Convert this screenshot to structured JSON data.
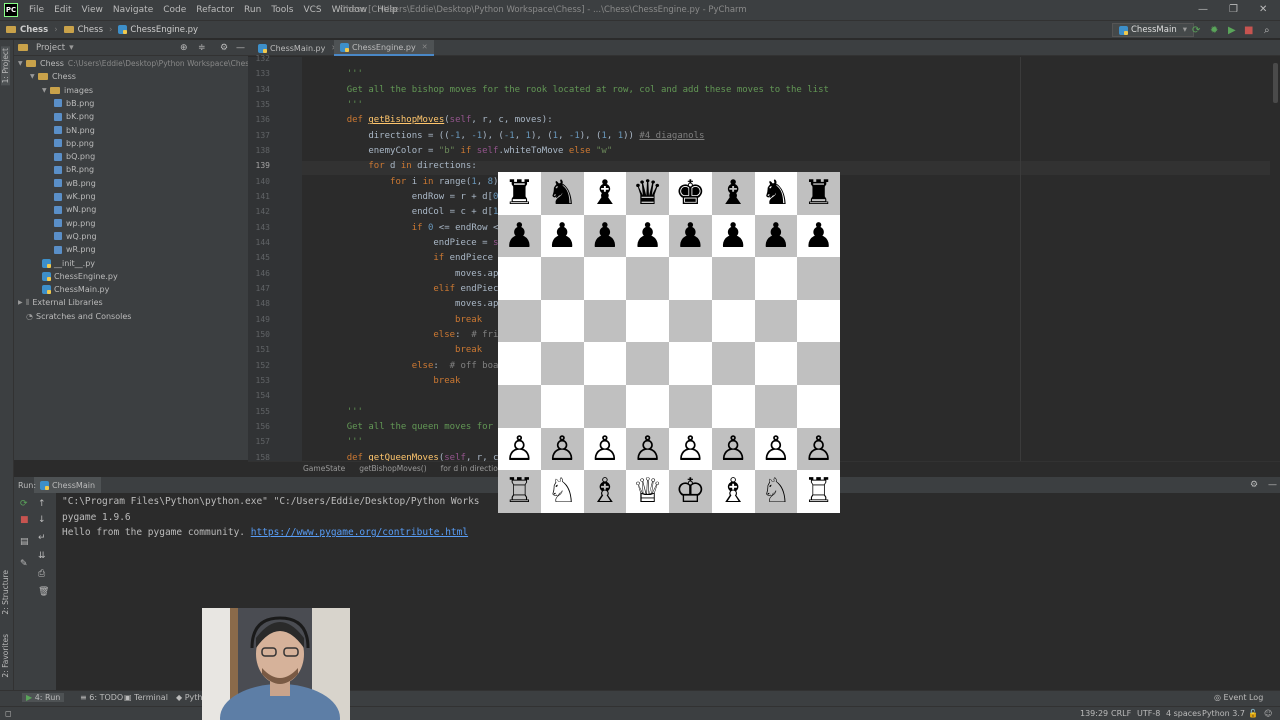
{
  "menubar": {
    "logo": "PC",
    "items": [
      "File",
      "Edit",
      "View",
      "Navigate",
      "Code",
      "Refactor",
      "Run",
      "Tools",
      "VCS",
      "Window",
      "Help"
    ],
    "title": "Chess [C:\\Users\\Eddie\\Desktop\\Python Workspace\\Chess] - ...\\Chess\\ChessEngine.py - PyCharm"
  },
  "navbar": {
    "crumbs": [
      "Chess",
      "Chess",
      "ChessEngine.py"
    ],
    "run_config": "ChessMain"
  },
  "left_strip": {
    "project_tab": "1: Project",
    "structure_tab": "2: Structure",
    "favorites_tab": "2: Favorites"
  },
  "project": {
    "title": "Project",
    "tree": [
      {
        "label": "Chess",
        "extra": "C:\\Users\\Eddie\\Desktop\\Python Workspace\\Chess",
        "type": "folder",
        "depth": 0,
        "open": true
      },
      {
        "label": "Chess",
        "type": "folder",
        "depth": 1,
        "open": true
      },
      {
        "label": "images",
        "type": "folder",
        "depth": 2,
        "open": true
      },
      {
        "label": "bB.png",
        "type": "img",
        "depth": 3
      },
      {
        "label": "bK.png",
        "type": "img",
        "depth": 3
      },
      {
        "label": "bN.png",
        "type": "img",
        "depth": 3
      },
      {
        "label": "bp.png",
        "type": "img",
        "depth": 3
      },
      {
        "label": "bQ.png",
        "type": "img",
        "depth": 3
      },
      {
        "label": "bR.png",
        "type": "img",
        "depth": 3
      },
      {
        "label": "wB.png",
        "type": "img",
        "depth": 3
      },
      {
        "label": "wK.png",
        "type": "img",
        "depth": 3
      },
      {
        "label": "wN.png",
        "type": "img",
        "depth": 3
      },
      {
        "label": "wp.png",
        "type": "img",
        "depth": 3
      },
      {
        "label": "wQ.png",
        "type": "img",
        "depth": 3
      },
      {
        "label": "wR.png",
        "type": "img",
        "depth": 3
      },
      {
        "label": "__init__.py",
        "type": "py",
        "depth": 2
      },
      {
        "label": "ChessEngine.py",
        "type": "py",
        "depth": 2
      },
      {
        "label": "ChessMain.py",
        "type": "py",
        "depth": 2
      },
      {
        "label": "External Libraries",
        "type": "lib",
        "depth": 0
      },
      {
        "label": "Scratches and Consoles",
        "type": "scratch",
        "depth": 0
      }
    ]
  },
  "editor": {
    "tabs": [
      {
        "label": "ChessMain.py",
        "active": false
      },
      {
        "label": "ChessEngine.py",
        "active": true
      }
    ],
    "current_line": 139,
    "lines": [
      {
        "n": 132,
        "html": ""
      },
      {
        "n": 133,
        "html": "    <span class='doc'>'''</span>"
      },
      {
        "n": 134,
        "html": "    <span class='doc'>Get all the bishop moves for the rook located at row, col and add these moves to the list</span>"
      },
      {
        "n": 135,
        "html": "    <span class='doc'>'''</span>"
      },
      {
        "n": 136,
        "html": "    <span class='kw'>def </span><span class='fn' style='text-decoration:underline'>getBishopMoves</span>(<span class='self'>self</span>, r, c, moves):"
      },
      {
        "n": 137,
        "html": "        directions = ((<span class='num'>-1</span>, <span class='num'>-1</span>), (<span class='num'>-1</span>, <span class='num'>1</span>), (<span class='num'>1</span>, <span class='num'>-1</span>), (<span class='num'>1</span>, <span class='num'>1</span>)) <span class='cmt' style='text-decoration:underline'>#4 diaganols</span>"
      },
      {
        "n": 138,
        "html": "        enemyColor = <span class='str'>\"b\"</span> <span class='kw'>if </span><span class='self'>self</span>.whiteToMove <span class='kw'>else </span><span class='str'>\"w\"</span>"
      },
      {
        "n": 139,
        "html": "        <span class='kw'>for </span>d <span class='kw'>in </span>directions:"
      },
      {
        "n": 140,
        "html": "            <span class='kw'>for </span>i <span class='kw'>in </span>range(<span class='num'>1</span>, <span class='num'>8</span>):"
      },
      {
        "n": 141,
        "html": "                endRow = r + d[<span class='num'>0</span>]"
      },
      {
        "n": 142,
        "html": "                endCol = c + d[<span class='num'>1</span>]"
      },
      {
        "n": 143,
        "html": "                <span class='kw'>if </span><span class='num'>0</span> &lt;= endRow &lt;"
      },
      {
        "n": 144,
        "html": "                    endPiece = <span class='self'>se</span>"
      },
      {
        "n": 145,
        "html": "                    <span class='kw'>if </span>endPiece ="
      },
      {
        "n": 146,
        "html": "                        moves.app"
      },
      {
        "n": 147,
        "html": "                    <span class='kw'>elif </span>endPiece"
      },
      {
        "n": 148,
        "html": "                        moves.app"
      },
      {
        "n": 149,
        "html": "                        <span class='kw'>break</span>"
      },
      {
        "n": 150,
        "html": "                    <span class='kw'>else</span>:  <span class='cmt'># frie</span>"
      },
      {
        "n": 151,
        "html": "                        <span class='kw'>break</span>"
      },
      {
        "n": 152,
        "html": "                <span class='kw'>else</span>:  <span class='cmt'># off boar</span>"
      },
      {
        "n": 153,
        "html": "                    <span class='kw'>break</span>"
      },
      {
        "n": 154,
        "html": ""
      },
      {
        "n": 155,
        "html": "    <span class='doc'>'''</span>"
      },
      {
        "n": 156,
        "html": "    <span class='doc'>Get all the queen moves for t                                                  st</span>"
      },
      {
        "n": 157,
        "html": "    <span class='doc'>'''</span>"
      },
      {
        "n": 158,
        "html": "    <span class='kw'>def </span><span class='fn'>getQueenMoves</span>(<span class='self'>self</span>, r, c"
      }
    ],
    "breadcrumb": [
      "GameState",
      "getBishopMoves()",
      "for d in directions"
    ]
  },
  "run": {
    "label": "Run:",
    "tab": "ChessMain",
    "console": [
      "\"C:\\Program Files\\Python\\python.exe\" \"C:/Users/Eddie/Desktop/Python Works",
      "pygame 1.9.6"
    ],
    "hello": "Hello from the pygame community. ",
    "link": "https://www.pygame.org/contribute.html"
  },
  "bottom_tabs": [
    "4: Run",
    "6: TODO",
    "Terminal",
    "Pyth"
  ],
  "event_log": "Event Log",
  "status": {
    "position": "139:29",
    "line_sep": "CRLF",
    "encoding": "UTF-8",
    "indent": "4 spaces",
    "interpreter": "Python 3.7"
  },
  "chess": {
    "light_color": "#ffffff",
    "dark_color": "#c0c0c0",
    "board": [
      [
        "bR",
        "bN",
        "bB",
        "bQ",
        "bK",
        "bB",
        "bN",
        "bR"
      ],
      [
        "bp",
        "bp",
        "bp",
        "bp",
        "bp",
        "bp",
        "bp",
        "bp"
      ],
      [
        "--",
        "--",
        "--",
        "--",
        "--",
        "--",
        "--",
        "--"
      ],
      [
        "--",
        "--",
        "--",
        "--",
        "--",
        "--",
        "--",
        "--"
      ],
      [
        "--",
        "--",
        "--",
        "--",
        "--",
        "--",
        "--",
        "--"
      ],
      [
        "--",
        "--",
        "--",
        "--",
        "--",
        "--",
        "--",
        "--"
      ],
      [
        "wp",
        "wp",
        "wp",
        "wp",
        "wp",
        "wp",
        "wp",
        "wp"
      ],
      [
        "wR",
        "wN",
        "wB",
        "wQ",
        "wK",
        "wB",
        "wN",
        "wR"
      ]
    ]
  }
}
